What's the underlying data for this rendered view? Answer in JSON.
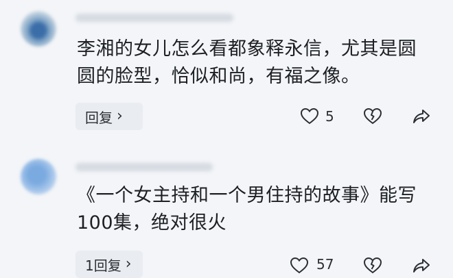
{
  "comments": [
    {
      "text": "李湘的女儿怎么看都象释永信，尤其是圆圆的脸型，恰似和尚，有福之像。",
      "reply_label": "回复",
      "like_count": "5"
    },
    {
      "text": "《一个女主持和一个男住持的故事》能写100集，绝对很火",
      "reply_label": "1回复",
      "like_count": "57"
    }
  ],
  "icons": {
    "like": "heart-outline-icon",
    "dislike": "broken-heart-icon",
    "share": "share-arrow-icon",
    "chevron": "chevron-right-icon"
  },
  "colors": {
    "background": "#f3f5f8",
    "text": "#1c1f23",
    "icon": "#2b2f35",
    "pill": "#e9ecf0"
  }
}
